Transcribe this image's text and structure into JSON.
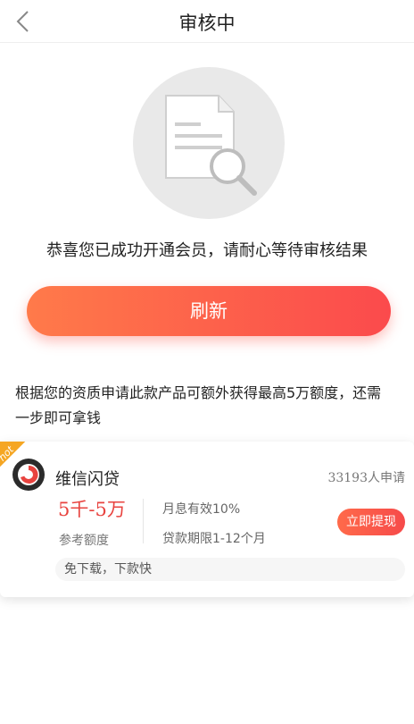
{
  "header": {
    "title": "审核中",
    "back_icon": "chevron-left-icon"
  },
  "illustration": {
    "icon": "document-search-icon"
  },
  "message": "恭喜您已成功开通会员，请耐心等待审核结果",
  "refresh_button": "刷新",
  "description": {
    "line1": "根据您的资质申请此款产品可额外获得最高5万额度，还需",
    "line2": "一步即可拿钱"
  },
  "product_card": {
    "badge": "hot",
    "name": "维信闪贷",
    "applicants": "33193人申请",
    "amount": "5千-5万",
    "amount_label": "参考额度",
    "rate": "月息有效10%",
    "term": "贷款期限1-12个月",
    "action": "立即提现",
    "tagline": "免下载，下款快"
  },
  "colors": {
    "accent_start": "#ff7a4a",
    "accent_end": "#fb4a4c",
    "amount_red": "#e8433f",
    "hot_badge": "#f5a623"
  }
}
